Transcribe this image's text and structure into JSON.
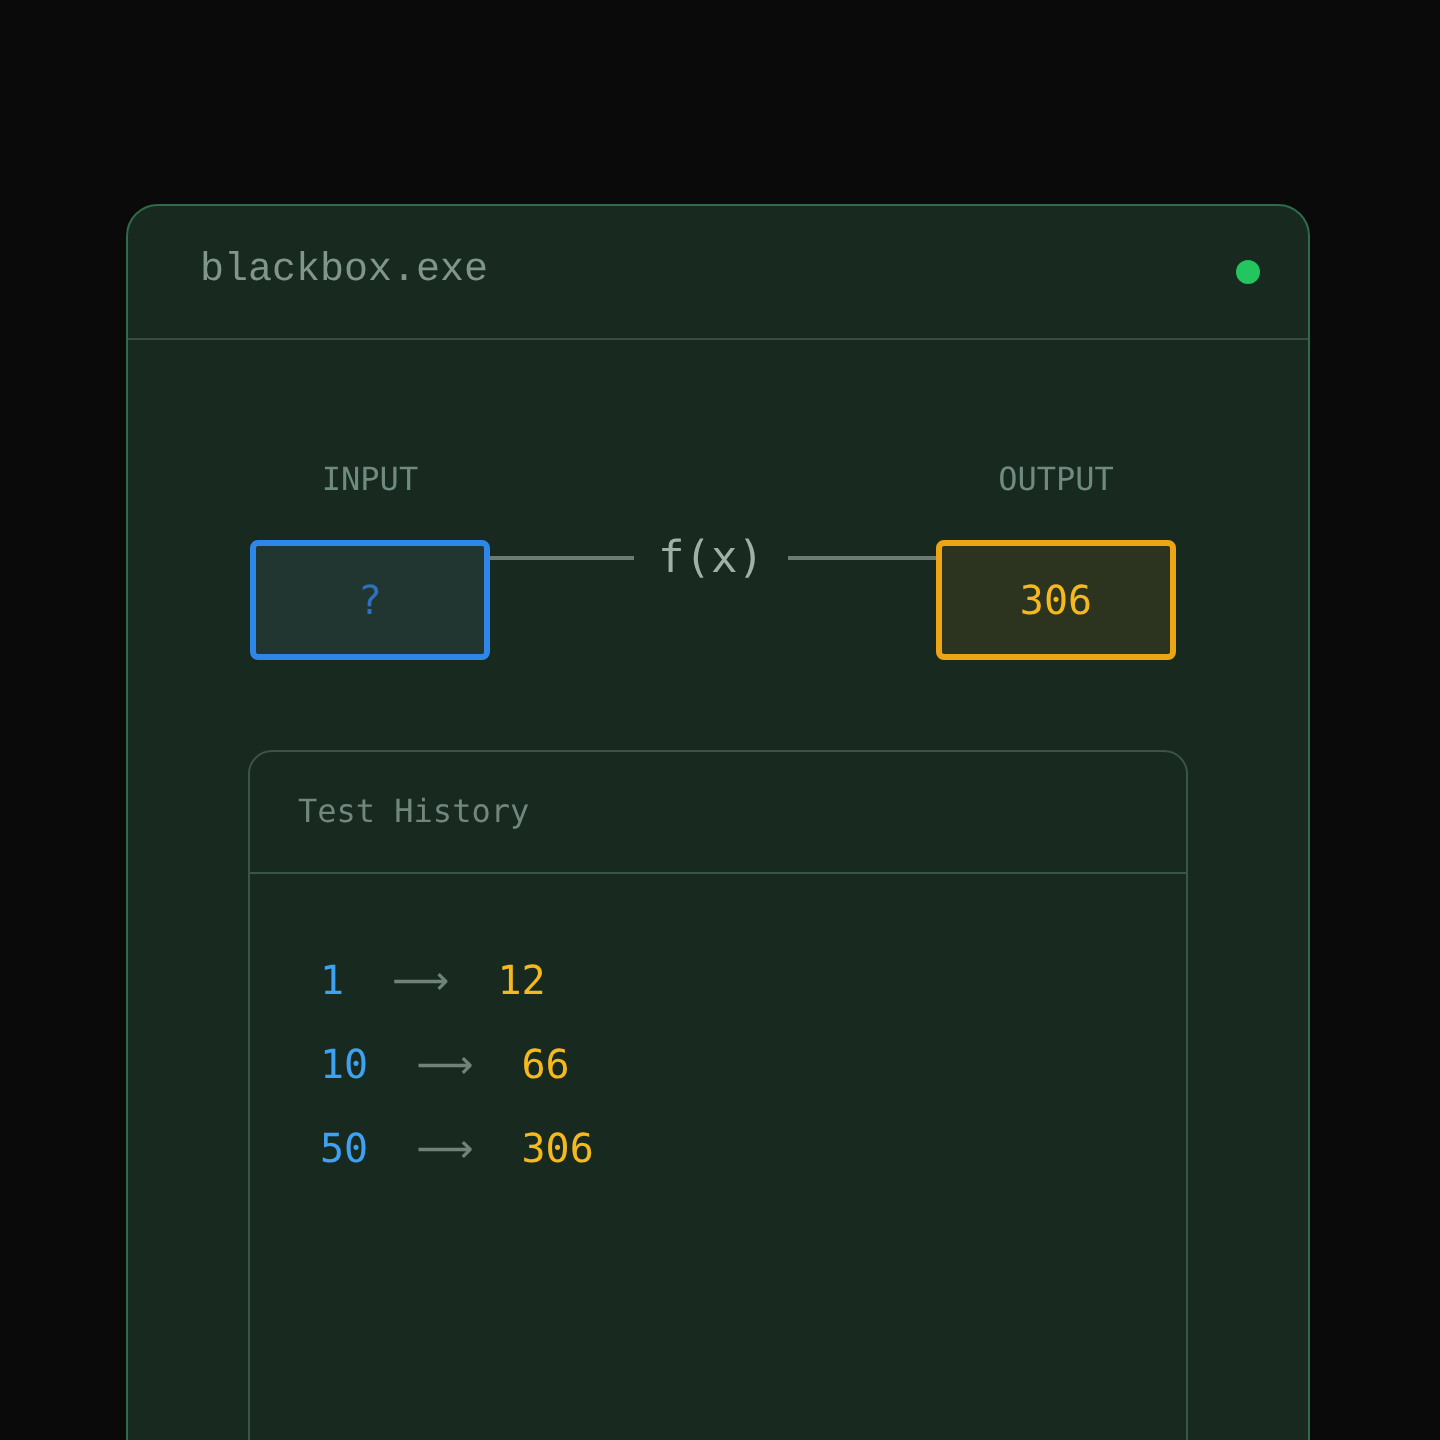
{
  "window": {
    "title": "blackbox.exe",
    "running": true
  },
  "input": {
    "label": "INPUT",
    "placeholder": "?"
  },
  "function_label": "f(x)",
  "output": {
    "label": "OUTPUT",
    "value": "306"
  },
  "history": {
    "title": "Test History",
    "rows": [
      {
        "input": "1",
        "arrow": "⟶",
        "output": "12"
      },
      {
        "input": "10",
        "arrow": "⟶",
        "output": "66"
      },
      {
        "input": "50",
        "arrow": "⟶",
        "output": "306"
      }
    ]
  }
}
